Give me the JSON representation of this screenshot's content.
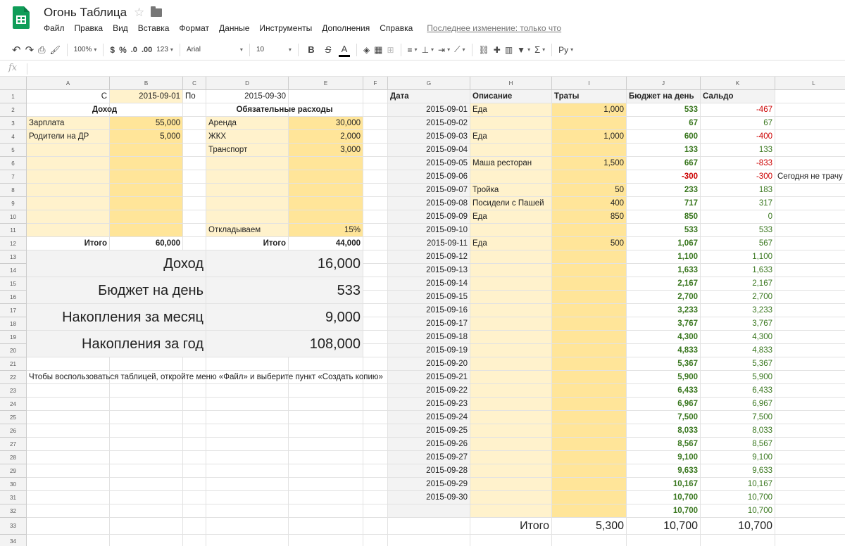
{
  "app": {
    "title": "Огонь Таблица",
    "menu": [
      "Файл",
      "Правка",
      "Вид",
      "Вставка",
      "Формат",
      "Данные",
      "Инструменты",
      "Дополнения",
      "Справка"
    ],
    "last_edit": "Последнее изменение: только что"
  },
  "toolbar": {
    "zoom": "100%",
    "currency": "$",
    "percent": "%",
    "dec_less": ".0",
    "dec_more": ".00",
    "format_more": "123",
    "font": "Arial",
    "size": "10",
    "bold": "B",
    "strike": "S",
    "text_color": "A",
    "input_tools": "Ру"
  },
  "formula_bar": {
    "fx": "fx"
  },
  "columns": [
    "A",
    "B",
    "C",
    "D",
    "E",
    "F",
    "G",
    "H",
    "I",
    "J",
    "K",
    "L"
  ],
  "rows": [
    "1",
    "2",
    "3",
    "4",
    "5",
    "6",
    "7",
    "8",
    "9",
    "10",
    "11",
    "12",
    "13",
    "14",
    "15",
    "16",
    "17",
    "18",
    "19",
    "20",
    "21",
    "22",
    "23",
    "24",
    "25",
    "26",
    "27",
    "28",
    "29",
    "30",
    "31",
    "32",
    "33",
    "34"
  ],
  "budget": {
    "from_label": "С",
    "from_date": "2015-09-01",
    "to_label": "По",
    "to_date": "2015-09-30",
    "income_header": "Доход",
    "income": [
      {
        "name": "Зарплата",
        "amount": "55,000"
      },
      {
        "name": "Родители на ДР",
        "amount": "5,000"
      }
    ],
    "income_total_label": "Итого",
    "income_total": "60,000",
    "expense_header": "Обязательные расходы",
    "expenses": [
      {
        "name": "Аренда",
        "amount": "30,000"
      },
      {
        "name": "ЖКХ",
        "amount": "2,000"
      },
      {
        "name": "Транспорт",
        "amount": "3,000"
      }
    ],
    "save_label": "Откладываем",
    "save_pct": "15%",
    "expense_total_label": "Итого",
    "expense_total": "44,000"
  },
  "summary": [
    {
      "label": "Доход",
      "value": "16,000"
    },
    {
      "label": "Бюджет на день",
      "value": "533"
    },
    {
      "label": "Накопления за месяц",
      "value": "9,000"
    },
    {
      "label": "Накопления за год",
      "value": "108,000"
    }
  ],
  "note": "Чтобы воспользоваться таблицей, откройте меню «Файл» и выберите пункт «Создать копию»",
  "ledger": {
    "headers": {
      "date": "Дата",
      "desc": "Описание",
      "spent": "Траты",
      "daily": "Бюджет на день",
      "balance": "Сальдо"
    },
    "rows": [
      {
        "date": "2015-09-01",
        "desc": "Еда",
        "spent": "1,000",
        "daily": "533",
        "balance": "-467"
      },
      {
        "date": "2015-09-02",
        "desc": "",
        "spent": "",
        "daily": "67",
        "balance": "67"
      },
      {
        "date": "2015-09-03",
        "desc": "Еда",
        "spent": "1,000",
        "daily": "600",
        "balance": "-400"
      },
      {
        "date": "2015-09-04",
        "desc": "",
        "spent": "",
        "daily": "133",
        "balance": "133"
      },
      {
        "date": "2015-09-05",
        "desc": "Маша ресторан",
        "spent": "1,500",
        "daily": "667",
        "balance": "-833"
      },
      {
        "date": "2015-09-06",
        "desc": "",
        "spent": "",
        "daily": "-300",
        "balance": "-300"
      },
      {
        "date": "2015-09-07",
        "desc": "Тройка",
        "spent": "50",
        "daily": "233",
        "balance": "183"
      },
      {
        "date": "2015-09-08",
        "desc": "Посидели с Пашей",
        "spent": "400",
        "daily": "717",
        "balance": "317"
      },
      {
        "date": "2015-09-09",
        "desc": "Еда",
        "spent": "850",
        "daily": "850",
        "balance": "0"
      },
      {
        "date": "2015-09-10",
        "desc": "",
        "spent": "",
        "daily": "533",
        "balance": "533"
      },
      {
        "date": "2015-09-11",
        "desc": "Еда",
        "spent": "500",
        "daily": "1,067",
        "balance": "567"
      },
      {
        "date": "2015-09-12",
        "desc": "",
        "spent": "",
        "daily": "1,100",
        "balance": "1,100"
      },
      {
        "date": "2015-09-13",
        "desc": "",
        "spent": "",
        "daily": "1,633",
        "balance": "1,633"
      },
      {
        "date": "2015-09-14",
        "desc": "",
        "spent": "",
        "daily": "2,167",
        "balance": "2,167"
      },
      {
        "date": "2015-09-15",
        "desc": "",
        "spent": "",
        "daily": "2,700",
        "balance": "2,700"
      },
      {
        "date": "2015-09-16",
        "desc": "",
        "spent": "",
        "daily": "3,233",
        "balance": "3,233"
      },
      {
        "date": "2015-09-17",
        "desc": "",
        "spent": "",
        "daily": "3,767",
        "balance": "3,767"
      },
      {
        "date": "2015-09-18",
        "desc": "",
        "spent": "",
        "daily": "4,300",
        "balance": "4,300"
      },
      {
        "date": "2015-09-19",
        "desc": "",
        "spent": "",
        "daily": "4,833",
        "balance": "4,833"
      },
      {
        "date": "2015-09-20",
        "desc": "",
        "spent": "",
        "daily": "5,367",
        "balance": "5,367"
      },
      {
        "date": "2015-09-21",
        "desc": "",
        "spent": "",
        "daily": "5,900",
        "balance": "5,900"
      },
      {
        "date": "2015-09-22",
        "desc": "",
        "spent": "",
        "daily": "6,433",
        "balance": "6,433"
      },
      {
        "date": "2015-09-23",
        "desc": "",
        "spent": "",
        "daily": "6,967",
        "balance": "6,967"
      },
      {
        "date": "2015-09-24",
        "desc": "",
        "spent": "",
        "daily": "7,500",
        "balance": "7,500"
      },
      {
        "date": "2015-09-25",
        "desc": "",
        "spent": "",
        "daily": "8,033",
        "balance": "8,033"
      },
      {
        "date": "2015-09-26",
        "desc": "",
        "spent": "",
        "daily": "8,567",
        "balance": "8,567"
      },
      {
        "date": "2015-09-27",
        "desc": "",
        "spent": "",
        "daily": "9,100",
        "balance": "9,100"
      },
      {
        "date": "2015-09-28",
        "desc": "",
        "spent": "",
        "daily": "9,633",
        "balance": "9,633"
      },
      {
        "date": "2015-09-29",
        "desc": "",
        "spent": "",
        "daily": "10,167",
        "balance": "10,167"
      },
      {
        "date": "2015-09-30",
        "desc": "",
        "spent": "",
        "daily": "10,700",
        "balance": "10,700"
      },
      {
        "date": "",
        "desc": "",
        "spent": "",
        "daily": "10,700",
        "balance": "10,700"
      }
    ],
    "note_row6": "Сегодня не трачу",
    "total_label": "Итого",
    "total_spent": "5,300",
    "total_daily": "10,700",
    "total_balance": "10,700"
  },
  "colors": {
    "yellow_light": "#fff2cc",
    "yellow": "#ffe599",
    "summary_gray": "#f3f3f3",
    "positive": "#38761d",
    "negative": "#cc0000"
  }
}
